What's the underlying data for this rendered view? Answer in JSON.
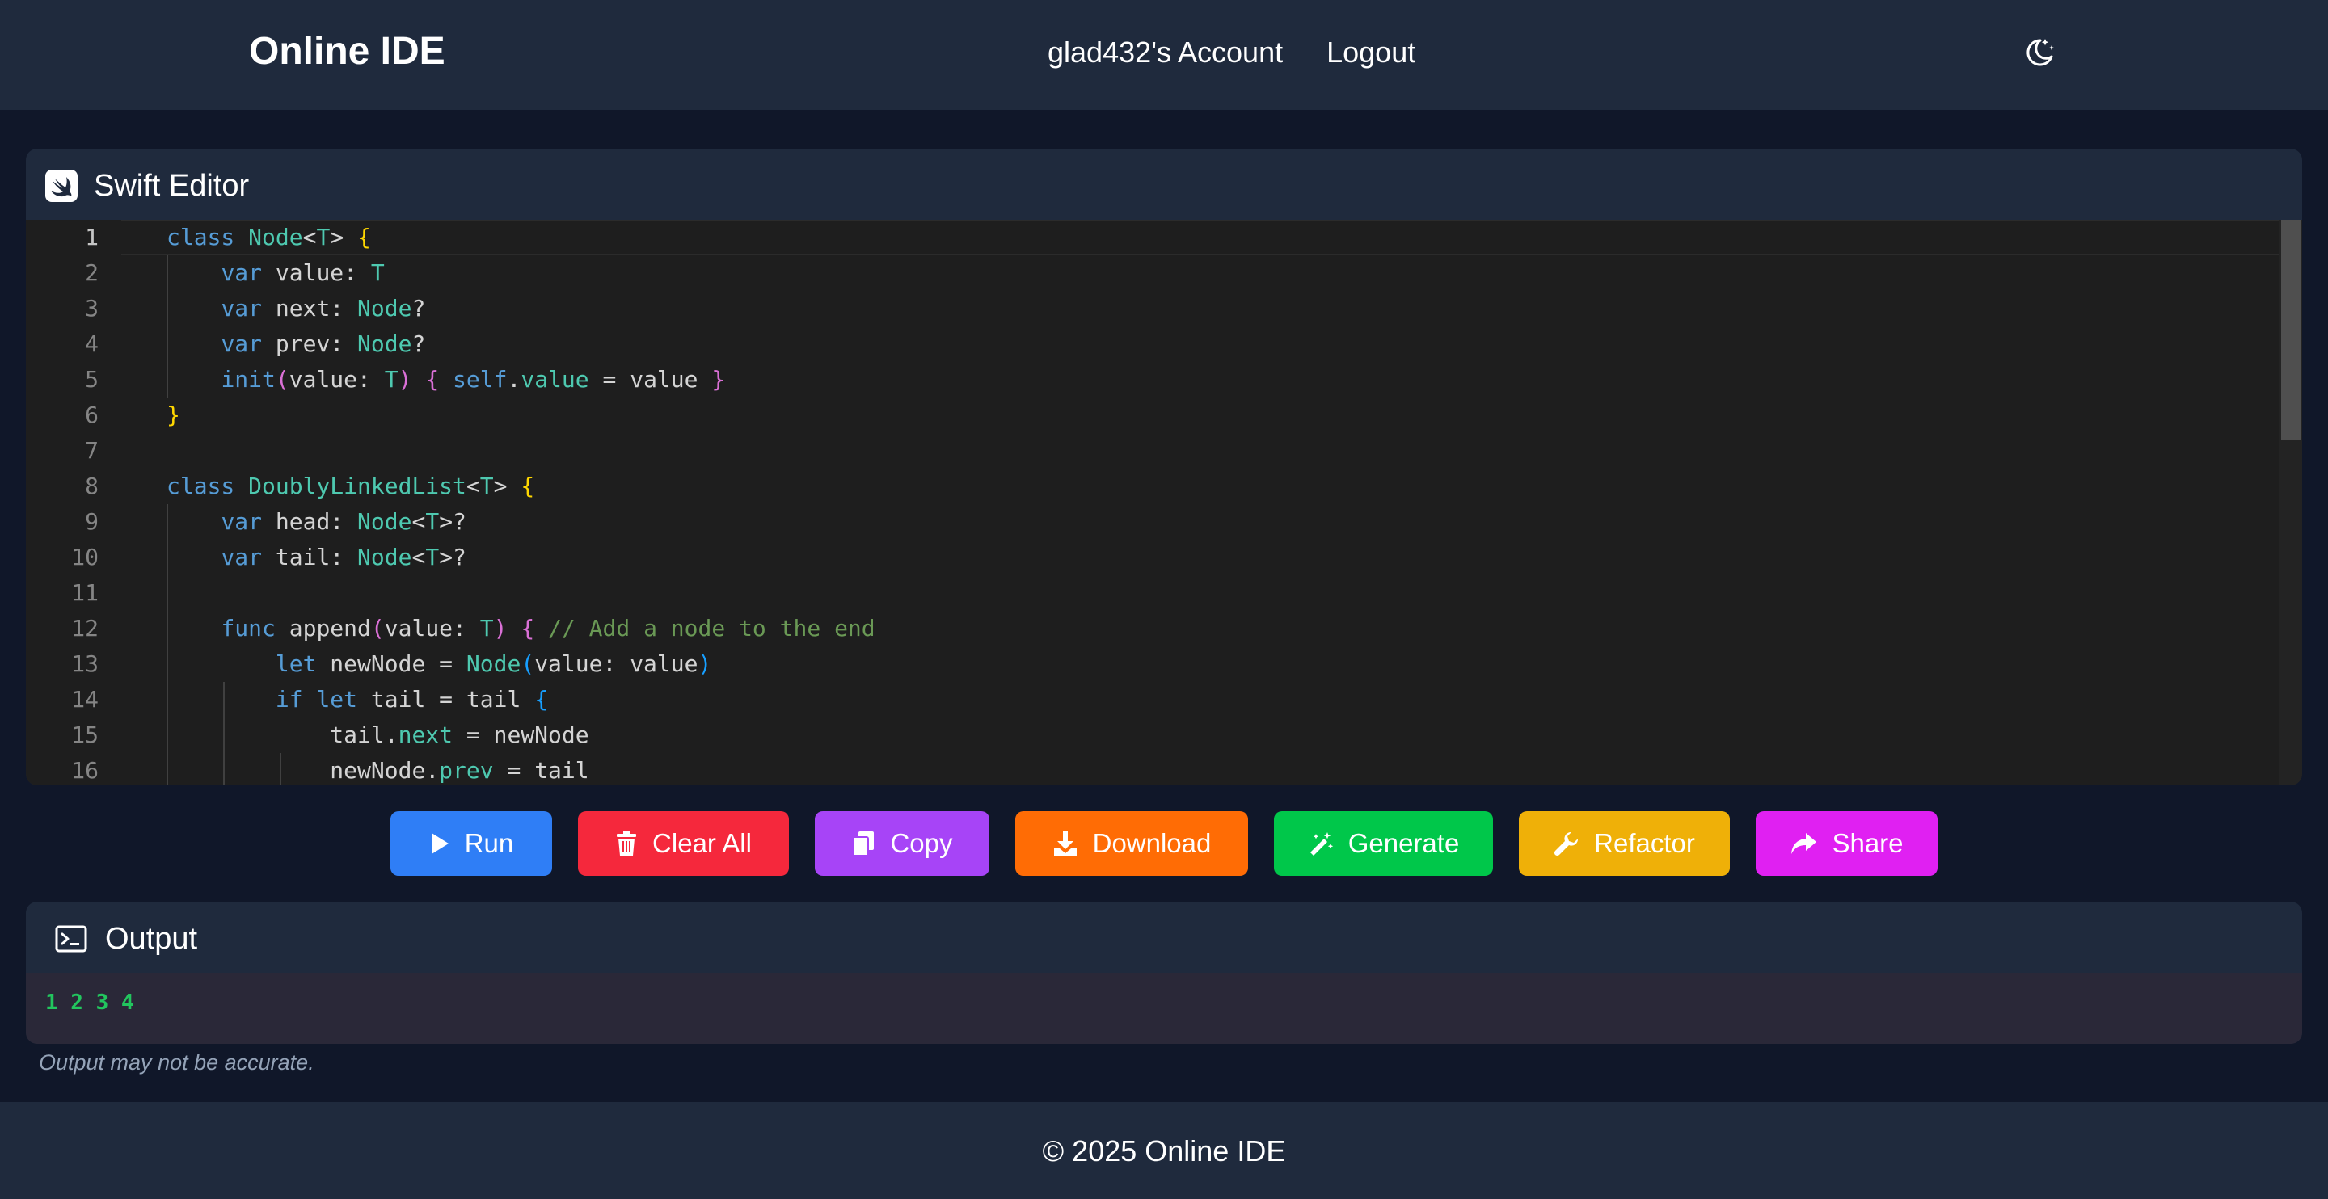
{
  "header": {
    "brand": "Online IDE",
    "account_label": "glad432's Account",
    "logout_label": "Logout",
    "theme_icon": "moon-stars-icon"
  },
  "editor": {
    "title": "Swift Editor",
    "icon": "swift-logo-icon",
    "active_line": 1,
    "line_numbers": [
      "1",
      "2",
      "3",
      "4",
      "5",
      "6",
      "7",
      "8",
      "9",
      "10",
      "11",
      "12",
      "13",
      "14",
      "15",
      "16"
    ],
    "code_lines": [
      "class Node<T> {",
      "    var value: T",
      "    var next: Node?",
      "    var prev: Node?",
      "    init(value: T) { self.value = value }",
      "}",
      "",
      "class DoublyLinkedList<T> {",
      "    var head: Node<T>?",
      "    var tail: Node<T>?",
      "",
      "    func append(value: T) { // Add a node to the end",
      "        let newNode = Node(value: value)",
      "        if let tail = tail {",
      "            tail.next = newNode",
      "            newNode.prev = tail"
    ]
  },
  "toolbar": {
    "run": "Run",
    "clear": "Clear All",
    "copy": "Copy",
    "download": "Download",
    "generate": "Generate",
    "refactor": "Refactor",
    "share": "Share"
  },
  "colors": {
    "run": "#2f7ef6",
    "clear": "#f5283c",
    "copy": "#a744f7",
    "download": "#ff6c05",
    "generate": "#00c74a",
    "refactor": "#efb008",
    "share": "#e020f2"
  },
  "output": {
    "title": "Output",
    "icon": "terminal-icon",
    "text": "1 2 3 4",
    "disclaimer": "Output may not be accurate."
  },
  "footer": {
    "text": "© 2025 Online IDE"
  }
}
